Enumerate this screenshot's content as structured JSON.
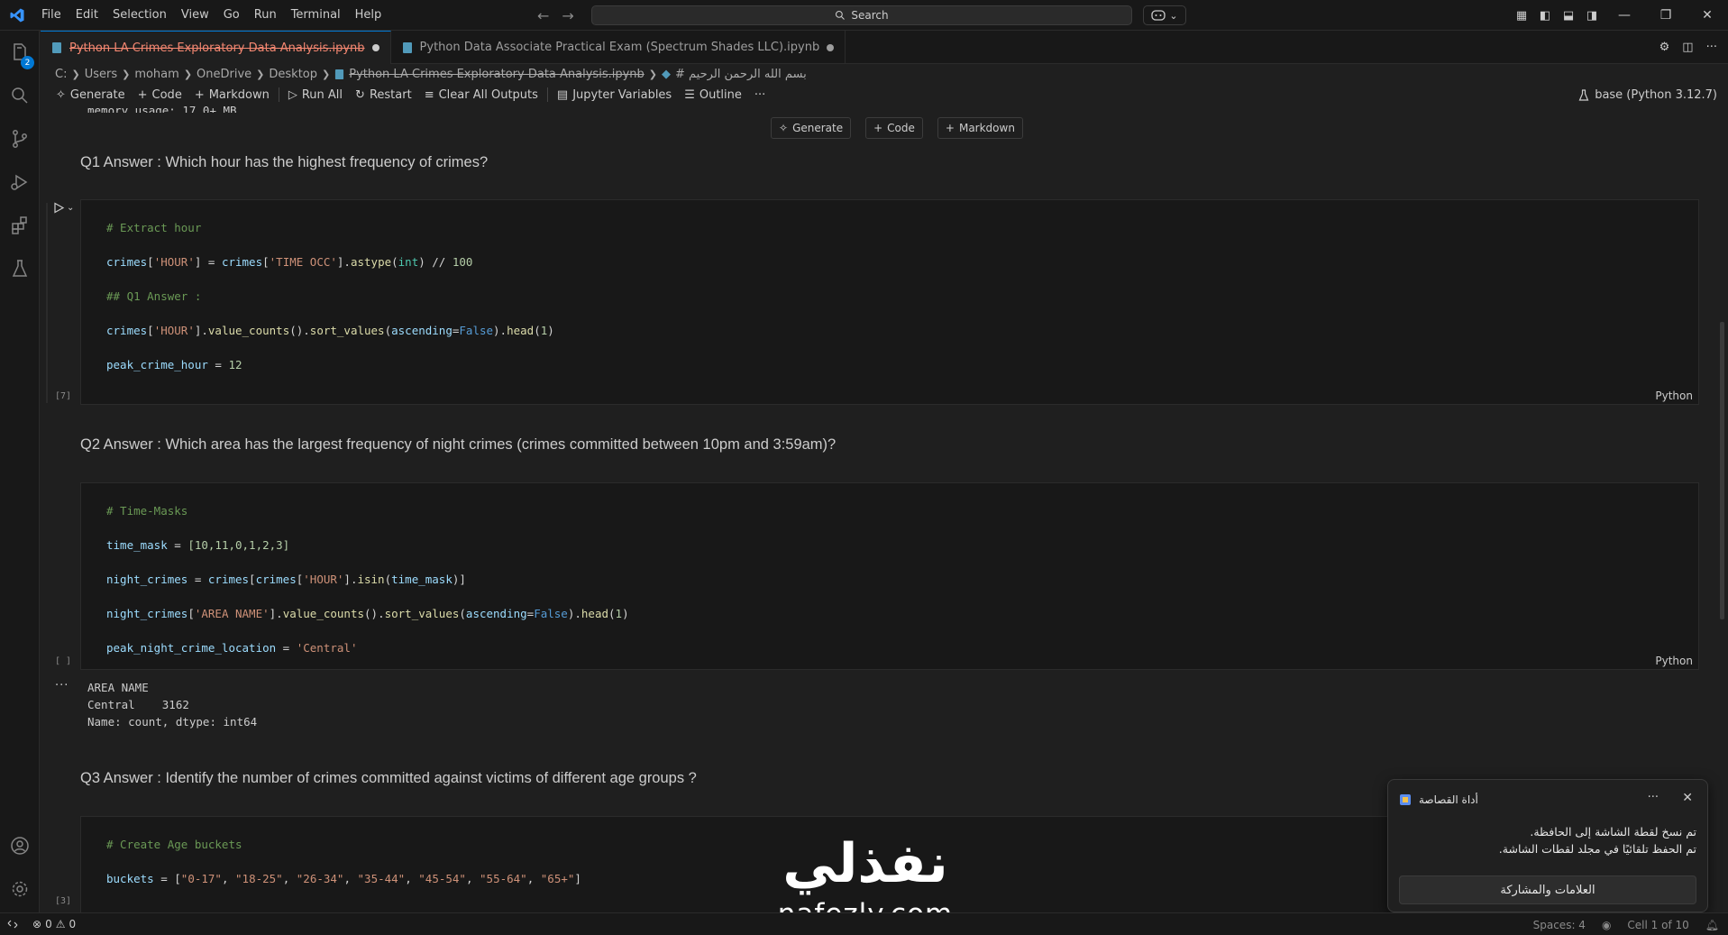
{
  "menu": [
    "File",
    "Edit",
    "Selection",
    "View",
    "Go",
    "Run",
    "Terminal",
    "Help"
  ],
  "search": {
    "label": "Search"
  },
  "activity": {
    "explorer_badge": "2"
  },
  "tabs": [
    {
      "label": "Python LA Crimes Exploratory Data Analysis.ipynb",
      "active": true
    },
    {
      "label": "Python Data Associate Practical Exam (Spectrum Shades LLC).ipynb",
      "active": false
    }
  ],
  "breadcrumb": [
    "C:",
    "Users",
    "moham",
    "OneDrive",
    "Desktop",
    "Python LA Crimes Exploratory Data Analysis.ipynb",
    "# بسم الله الرحمن الرحيم"
  ],
  "toolbar": {
    "generate": "Generate",
    "code": "Code",
    "markdown": "Markdown",
    "run_all": "Run All",
    "restart": "Restart",
    "clear_outputs": "Clear All Outputs",
    "jupyter_variables": "Jupyter Variables",
    "outline": "Outline",
    "more": "···",
    "kernel": "base (Python 3.12.7)"
  },
  "notebook": {
    "stale_output": "memory usage: 17.0+ MB",
    "insert": {
      "generate": "Generate",
      "code": "Code",
      "markdown": "Markdown"
    },
    "q1": "Q1 Answer : Which hour has the highest frequency of crimes?",
    "q2": "Q2 Answer : Which area has the largest frequency of night crimes (crimes committed between 10pm and 3:59am)?",
    "q3": "Q3 Answer : Identify the number of crimes committed against victims of different age groups ?",
    "cell1": {
      "exec_count": "[7]",
      "language": "Python",
      "l1": "# Extract hour",
      "l3": "## Q1 Answer :",
      "hour_key": "'HOUR'",
      "time_occ_key": "'TIME OCC'",
      "int_kw": "int",
      "floor_div": "100",
      "ascending_false": "False",
      "head_n": "1",
      "peak_var": "peak_crime_hour",
      "peak_val": "12"
    },
    "cell2": {
      "exec_count": "[ ]",
      "language": "Python",
      "l1": "# Time-Masks",
      "mask_values": "[10,11,0,1,2,3]",
      "area_key": "'AREA NAME'",
      "peak_location": "'Central'"
    },
    "cell2_output": {
      "header": "AREA NAME",
      "row": "Central    3162",
      "footer": "Name: count, dtype: int64"
    },
    "cell3": {
      "exec_count": "[3]",
      "l1": "# Create Age buckets",
      "buckets": [
        "\"0-17\"",
        "\"18-25\"",
        "\"26-34\"",
        "\"35-44\"",
        "\"45-54\"",
        "\"55-64\"",
        "\"65+\""
      ]
    }
  },
  "toast": {
    "app_name": "أداة القصاصة",
    "line1": "تم نسخ لقطة الشاشة إلى الحافظة.",
    "line2": "تم الحفظ تلقائيًا في مجلد لقطات الشاشة.",
    "button": "العلامات والمشاركة"
  },
  "watermark": {
    "arabic": "نفذلي",
    "latin": "nafezly.com"
  },
  "statusbar": {
    "errors": "0",
    "warnings": "0",
    "spaces": "Spaces: 4",
    "cell": "Cell 1 of 10"
  },
  "colors": {
    "accent": "#0078d4",
    "deleted_tab": "#f48771",
    "comment": "#6a9955",
    "string": "#ce9178",
    "variable": "#9cdcfe",
    "function": "#dcdcaa",
    "keyword": "#569cd6"
  }
}
